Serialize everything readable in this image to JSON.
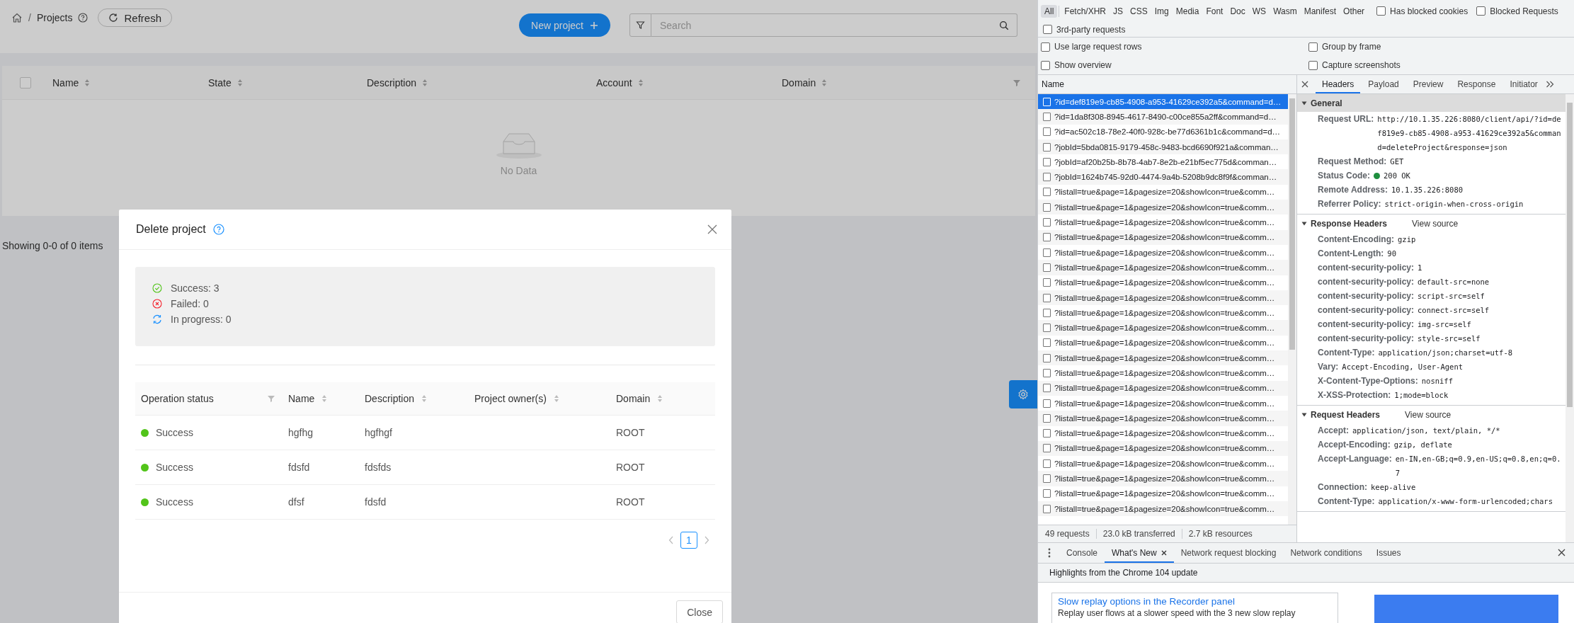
{
  "app": {
    "breadcrumb": {
      "separator": "/",
      "current": "Projects"
    },
    "refresh_button": "Refresh",
    "new_project_button": "New project",
    "search": {
      "placeholder": "Search"
    },
    "table": {
      "select_all_checked": false,
      "columns": [
        "Name",
        "State",
        "Description",
        "Account",
        "Domain"
      ],
      "empty_text": "No Data"
    },
    "footer_text": "Showing 0-0 of 0 items"
  },
  "modal": {
    "title": "Delete project",
    "summary": [
      {
        "kind": "success",
        "label": "Success: 3"
      },
      {
        "kind": "failed",
        "label": "Failed: 0"
      },
      {
        "kind": "progress",
        "label": "In progress: 0"
      }
    ],
    "columns": [
      {
        "label": "Operation status",
        "kind": "filter"
      },
      {
        "label": "Name",
        "kind": "sort"
      },
      {
        "label": "Description",
        "kind": "sort"
      },
      {
        "label": "Project owner(s)",
        "kind": "sort"
      },
      {
        "label": "Domain",
        "kind": "sort"
      }
    ],
    "rows": [
      {
        "status": "Success",
        "color": "#52c41a",
        "name": "hgfhg",
        "description": "hgfhgf",
        "domain": "ROOT"
      },
      {
        "status": "Success",
        "color": "#52c41a",
        "name": "fdsfd",
        "description": "fdsfds",
        "domain": "ROOT"
      },
      {
        "status": "Success",
        "color": "#52c41a",
        "name": "dfsf",
        "description": "fdsfd",
        "domain": "ROOT"
      }
    ],
    "pages": [
      {
        "label": "1",
        "selected": true
      }
    ],
    "close_button": "Close"
  },
  "devtools": {
    "filters": [
      {
        "label": "All",
        "selected": true
      },
      {
        "label": "Fetch/XHR",
        "selected": false
      },
      {
        "label": "JS",
        "selected": false
      },
      {
        "label": "CSS",
        "selected": false
      },
      {
        "label": "Img",
        "selected": false
      },
      {
        "label": "Media",
        "selected": false
      },
      {
        "label": "Font",
        "selected": false
      },
      {
        "label": "Doc",
        "selected": false
      },
      {
        "label": "WS",
        "selected": false
      },
      {
        "label": "Wasm",
        "selected": false
      },
      {
        "label": "Manifest",
        "selected": false
      },
      {
        "label": "Other",
        "selected": false
      }
    ],
    "filter_checkboxes": [
      {
        "label": "Has blocked cookies",
        "checked": false
      },
      {
        "label": "Blocked Requests",
        "checked": false
      },
      {
        "label": "3rd-party requests",
        "checked": false
      }
    ],
    "settings": [
      {
        "label": "Use large request rows",
        "checked": false
      },
      {
        "label": "Group by frame",
        "checked": false
      },
      {
        "label": "Show overview",
        "checked": false
      },
      {
        "label": "Capture screenshots",
        "checked": false
      }
    ],
    "list_column": "Name",
    "requests": [
      {
        "name": "?id=def819e9-cb85-4908-a953-41629ce392a5&command=d…",
        "selected": true
      },
      {
        "name": "?id=1da8f308-8945-4617-8490-c00ce855a2ff&command=d…",
        "selected": false
      },
      {
        "name": "?id=ac502c18-78e2-40f0-928c-be77d6361b1c&command=d…",
        "selected": false
      },
      {
        "name": "?jobId=5bda0815-9179-458c-9483-bcd6690f921a&comman…",
        "selected": false
      },
      {
        "name": "?jobId=af20b25b-8b78-4ab7-8e2b-e21bf5ec775d&comman…",
        "selected": false
      },
      {
        "name": "?jobId=1624b745-92d0-4474-9a4b-5208b9dc8f9f&comman…",
        "selected": false
      },
      {
        "name": "?listall=true&page=1&pagesize=20&showIcon=true&comm…",
        "selected": false
      },
      {
        "name": "?listall=true&page=1&pagesize=20&showIcon=true&comm…",
        "selected": false
      },
      {
        "name": "?listall=true&page=1&pagesize=20&showIcon=true&comm…",
        "selected": false
      },
      {
        "name": "?listall=true&page=1&pagesize=20&showIcon=true&comm…",
        "selected": false
      },
      {
        "name": "?listall=true&page=1&pagesize=20&showIcon=true&comm…",
        "selected": false
      },
      {
        "name": "?listall=true&page=1&pagesize=20&showIcon=true&comm…",
        "selected": false
      },
      {
        "name": "?listall=true&page=1&pagesize=20&showIcon=true&comm…",
        "selected": false
      },
      {
        "name": "?listall=true&page=1&pagesize=20&showIcon=true&comm…",
        "selected": false
      },
      {
        "name": "?listall=true&page=1&pagesize=20&showIcon=true&comm…",
        "selected": false
      },
      {
        "name": "?listall=true&page=1&pagesize=20&showIcon=true&comm…",
        "selected": false
      },
      {
        "name": "?listall=true&page=1&pagesize=20&showIcon=true&comm…",
        "selected": false
      },
      {
        "name": "?listall=true&page=1&pagesize=20&showIcon=true&comm…",
        "selected": false
      },
      {
        "name": "?listall=true&page=1&pagesize=20&showIcon=true&comm…",
        "selected": false
      },
      {
        "name": "?listall=true&page=1&pagesize=20&showIcon=true&comm…",
        "selected": false
      },
      {
        "name": "?listall=true&page=1&pagesize=20&showIcon=true&comm…",
        "selected": false
      },
      {
        "name": "?listall=true&page=1&pagesize=20&showIcon=true&comm…",
        "selected": false
      },
      {
        "name": "?listall=true&page=1&pagesize=20&showIcon=true&comm…",
        "selected": false
      },
      {
        "name": "?listall=true&page=1&pagesize=20&showIcon=true&comm…",
        "selected": false
      },
      {
        "name": "?listall=true&page=1&pagesize=20&showIcon=true&comm…",
        "selected": false
      },
      {
        "name": "?listall=true&page=1&pagesize=20&showIcon=true&comm…",
        "selected": false
      },
      {
        "name": "?listall=true&page=1&pagesize=20&showIcon=true&comm…",
        "selected": false
      },
      {
        "name": "?listall=true&page=1&pagesize=20&showIcon=true&comm…",
        "selected": false
      }
    ],
    "summary": [
      "49 requests",
      "23.0 kB transferred",
      "2.7 kB resources"
    ],
    "detail_tabs": [
      {
        "label": "Headers",
        "selected": true
      },
      {
        "label": "Payload",
        "selected": false
      },
      {
        "label": "Preview",
        "selected": false
      },
      {
        "label": "Response",
        "selected": false
      },
      {
        "label": "Initiator",
        "selected": false
      }
    ],
    "sections": [
      {
        "title": "General",
        "expanded": true,
        "headers": [
          {
            "name": "Request URL:",
            "value": "http://10.1.35.226:8080/client/api/?id=def819e9-cb85-4908-a953-41629ce392a5&command=deleteProject&response=json"
          },
          {
            "name": "Request Method:",
            "value": "GET"
          },
          {
            "name": "Status Code:",
            "value": "200 OK",
            "kind": "status"
          },
          {
            "name": "Remote Address:",
            "value": "10.1.35.226:8080"
          },
          {
            "name": "Referrer Policy:",
            "value": "strict-origin-when-cross-origin"
          }
        ]
      },
      {
        "title": "Response Headers",
        "expanded": true,
        "view_source": "View source",
        "headers": [
          {
            "name": "Content-Encoding:",
            "value": "gzip"
          },
          {
            "name": "Content-Length:",
            "value": "90"
          },
          {
            "name": "content-security-policy:",
            "value": "1"
          },
          {
            "name": "content-security-policy:",
            "value": "default-src=none"
          },
          {
            "name": "content-security-policy:",
            "value": "script-src=self"
          },
          {
            "name": "content-security-policy:",
            "value": "connect-src=self"
          },
          {
            "name": "content-security-policy:",
            "value": "img-src=self"
          },
          {
            "name": "content-security-policy:",
            "value": "style-src=self"
          },
          {
            "name": "Content-Type:",
            "value": "application/json;charset=utf-8"
          },
          {
            "name": "Vary:",
            "value": "Accept-Encoding, User-Agent"
          },
          {
            "name": "X-Content-Type-Options:",
            "value": "nosniff"
          },
          {
            "name": "X-XSS-Protection:",
            "value": "1;mode=block"
          }
        ]
      },
      {
        "title": "Request Headers",
        "expanded": true,
        "view_source": "View source",
        "headers": [
          {
            "name": "Accept:",
            "value": "application/json, text/plain, */*"
          },
          {
            "name": "Accept-Encoding:",
            "value": "gzip, deflate"
          },
          {
            "name": "Accept-Language:",
            "value": "en-IN,en-GB;q=0.9,en-US;q=0.8,en;q=0.7"
          },
          {
            "name": "Connection:",
            "value": "keep-alive"
          },
          {
            "name": "Content-Type:",
            "value": "application/x-www-form-urlencoded;chars"
          }
        ]
      }
    ],
    "drawer_tabs": [
      {
        "label": "Console",
        "selected": false,
        "closable": false
      },
      {
        "label": "What's New",
        "selected": true,
        "closable": true
      },
      {
        "label": "Network request blocking",
        "selected": false,
        "closable": false
      },
      {
        "label": "Network conditions",
        "selected": false,
        "closable": false
      },
      {
        "label": "Issues",
        "selected": false,
        "closable": false
      }
    ],
    "drawer_heading": "Highlights from the Chrome 104 update",
    "card": {
      "title": "Slow replay options in the Recorder panel",
      "text": "Replay user flows at a slower speed with the 3 new slow replay"
    }
  }
}
